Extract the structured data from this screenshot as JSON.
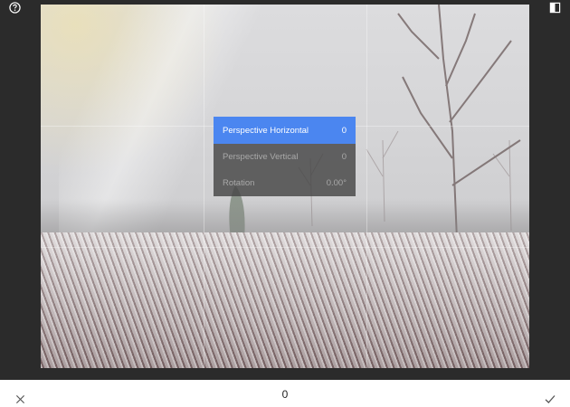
{
  "toolbar": {
    "help_icon": "help-circle-icon",
    "compare_icon": "compare-split-icon"
  },
  "menu": {
    "items": [
      {
        "label": "Perspective Horizontal",
        "value": "0",
        "selected": true
      },
      {
        "label": "Perspective Vertical",
        "value": "0",
        "selected": false
      },
      {
        "label": "Rotation",
        "value": "0.00°",
        "selected": false
      }
    ]
  },
  "bottom": {
    "current_value": "0",
    "cancel_icon": "close-icon",
    "apply_icon": "checkmark-icon"
  },
  "colors": {
    "accent": "#4b86f0",
    "background": "#2b2b2b",
    "bottom_bar": "#ffffff"
  }
}
